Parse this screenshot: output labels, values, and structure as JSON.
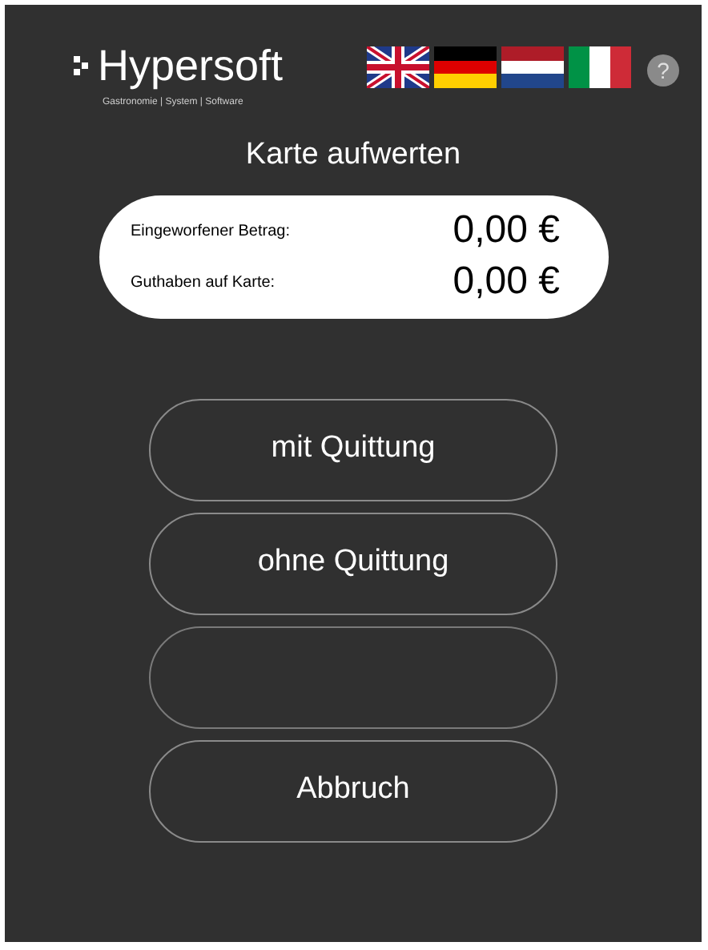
{
  "header": {
    "logo": "Hypersoft",
    "tagline": "Gastronomie | System | Software",
    "languages": [
      {
        "kind": "uk"
      },
      {
        "kind": "de"
      },
      {
        "kind": "nl"
      },
      {
        "kind": "it"
      }
    ],
    "help": "?"
  },
  "title": "Karte aufwerten",
  "amounts": [
    {
      "label": "Eingeworfener Betrag:",
      "value": "0,00 €"
    },
    {
      "label": "Guthaben auf Karte:",
      "value": "0,00 €"
    }
  ],
  "buttons": [
    {
      "kind": "text",
      "label": "mit Quittung"
    },
    {
      "kind": "text",
      "label": "ohne Quittung"
    },
    {
      "kind": "blank"
    },
    {
      "kind": "text",
      "label": "Abbruch"
    }
  ]
}
